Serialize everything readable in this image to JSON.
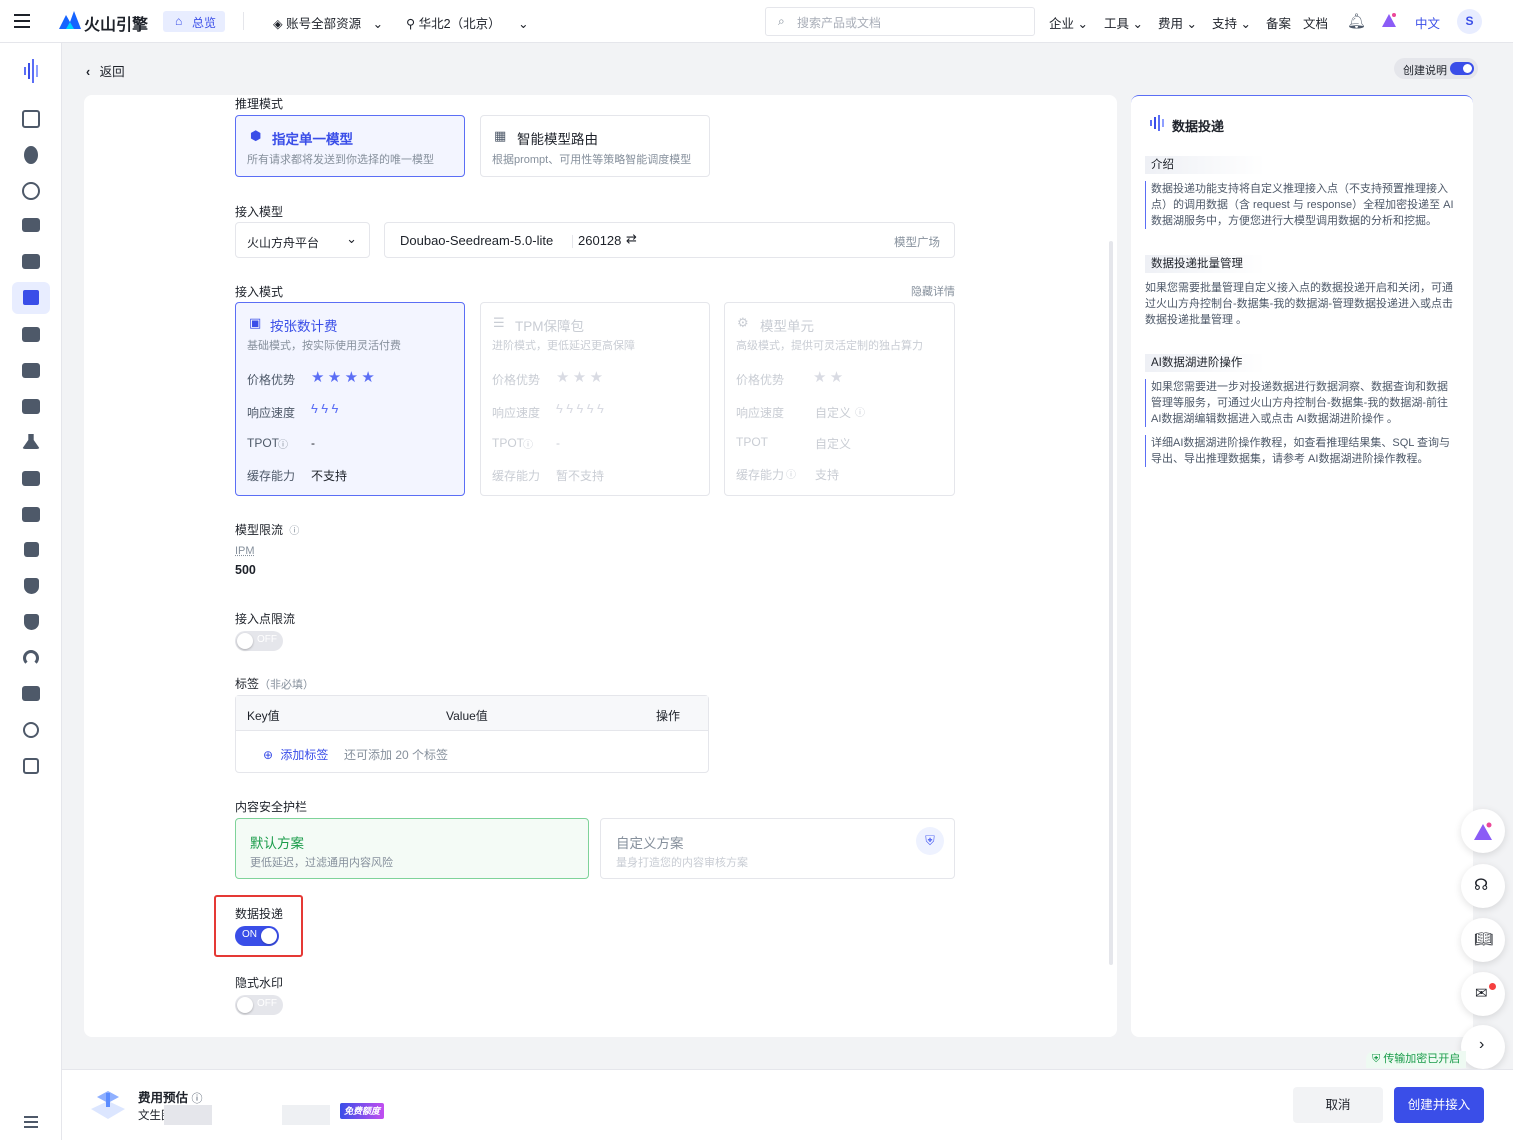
{
  "topbar": {
    "brand": "火山引擎",
    "home_tab": "总览",
    "account_selector": "账号全部资源",
    "region_selector": "华北2（北京）",
    "search_placeholder": "搜索产品或文档",
    "nav": [
      "企业",
      "工具",
      "费用",
      "支持",
      "备案",
      "文档"
    ],
    "language": "中文",
    "avatar": "S"
  },
  "header": {
    "back_label": "返回",
    "guide_toggle_label": "创建说明"
  },
  "form": {
    "inference_mode_label": "推理模式",
    "inference_modes": [
      {
        "title": "指定单一模型",
        "desc": "所有请求都将发送到你选择的唯一模型",
        "selected": true
      },
      {
        "title": "智能模型路由",
        "desc": "根据prompt、可用性等策略智能调度模型",
        "selected": false
      }
    ],
    "model_label": "接入模型",
    "platform_value": "火山方舟平台",
    "model_name": "Doubao-Seedream-5.0-lite",
    "model_version": "260128",
    "model_square_link": "模型广场",
    "access_mode_label": "接入模式",
    "hide_details_link": "隐藏详情",
    "access_modes": [
      {
        "title": "按张数计费",
        "desc": "基础模式，按实际使用灵活付费",
        "rows": [
          {
            "k": "价格优势",
            "v": ""
          },
          {
            "k": "响应速度",
            "v": ""
          },
          {
            "k": "TPOT",
            "v": "-"
          },
          {
            "k": "缓存能力",
            "v": "不支持"
          }
        ]
      },
      {
        "title": "TPM保障包",
        "desc": "进阶模式，更低延迟更高保障",
        "rows": [
          {
            "k": "价格优势",
            "v": ""
          },
          {
            "k": "响应速度",
            "v": ""
          },
          {
            "k": "TPOT",
            "v": "-"
          },
          {
            "k": "缓存能力",
            "v": "暂不支持"
          }
        ]
      },
      {
        "title": "模型单元",
        "desc": "高级模式，提供可灵活定制的独占算力",
        "rows": [
          {
            "k": "价格优势",
            "v": ""
          },
          {
            "k": "响应速度",
            "v": "自定义"
          },
          {
            "k": "TPOT",
            "v": "自定义"
          },
          {
            "k": "缓存能力",
            "v": "支持"
          }
        ]
      }
    ],
    "rate_limit_label": "模型限流",
    "ipm_label": "IPM",
    "ipm_value": "500",
    "endpoint_limit_label": "接入点限流",
    "toggle_off": "OFF",
    "toggle_on": "ON",
    "tags_label": "标签",
    "tags_optional": "（非必填）",
    "tags_columns": [
      "Key值",
      "Value值",
      "操作"
    ],
    "add_tag": "添加标签",
    "tags_remaining": "还可添加 20 个标签",
    "guardrail_label": "内容安全护栏",
    "guardrails": [
      {
        "title": "默认方案",
        "desc": "更低延迟，过滤通用内容风险"
      },
      {
        "title": "自定义方案",
        "desc": "量身打造您的内容审核方案"
      }
    ],
    "data_delivery_label": "数据投递",
    "watermark_label": "隐式水印"
  },
  "right_panel": {
    "title": "数据投递",
    "sections": [
      {
        "heading": "介绍",
        "paras": [
          "数据投递功能支持将自定义推理接入点（不支持预置推理接入点）的调用数据（含 request 与 response）全程加密投递至 AI 数据湖服务中，方便您进行大模型调用数据的分析和挖掘。"
        ]
      },
      {
        "heading": "数据投递批量管理",
        "paras": [
          "如果您需要批量管理自定义接入点的数据投递开启和关闭，可通过火山方舟控制台-数据集-我的数据湖-管理数据投递进入或点击 数据投递批量管理 。"
        ]
      },
      {
        "heading": "AI数据湖进阶操作",
        "paras": [
          "如果您需要进一步对投递数据进行数据洞察、数据查询和数据管理等服务，可通过火山方舟控制台-数据集-我的数据湖-前往AI数据湖编辑数据进入或点击 AI数据湖进阶操作 。",
          "详细AI数据湖进阶操作教程，如查看推理结果集、SQL 查询与导出、导出推理数据集，请参考 AI数据湖进阶操作教程。"
        ]
      }
    ]
  },
  "footer": {
    "encrypt_badge": "传输加密已开启",
    "cost_label": "费用预估",
    "cost_prefix": "文生图",
    "free_quota_badge": "免费额度",
    "cancel": "取消",
    "create": "创建并接入"
  }
}
